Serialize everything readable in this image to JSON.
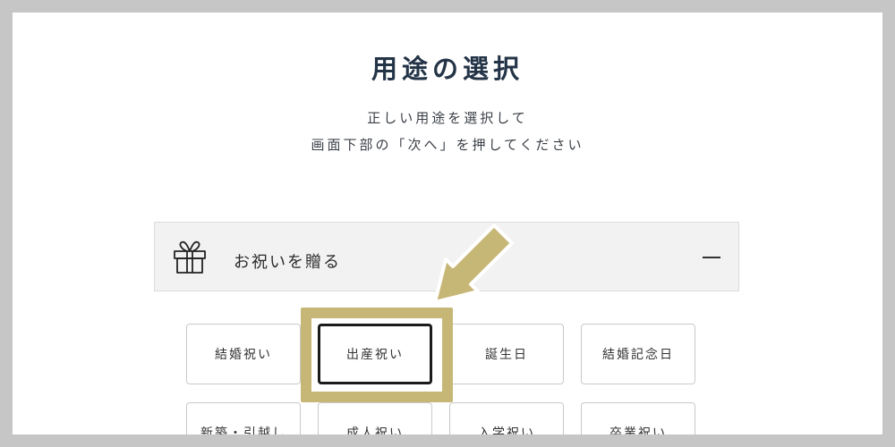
{
  "page": {
    "title": "用途の選択",
    "instruction_line1": "正しい用途を選択して",
    "instruction_line2": "画面下部の「次へ」を押してください"
  },
  "accordion": {
    "label": "お祝いを贈る",
    "icon": "gift-icon",
    "toggle_icon": "minus-icon",
    "expanded": true
  },
  "options": [
    {
      "label": "結婚祝い",
      "selected": false
    },
    {
      "label": "出産祝い",
      "selected": true
    },
    {
      "label": "誕生日",
      "selected": false
    },
    {
      "label": "結婚記念日",
      "selected": false
    },
    {
      "label": "新築・引越し",
      "selected": false
    },
    {
      "label": "成人祝い",
      "selected": false
    },
    {
      "label": "入学祝い",
      "selected": false
    },
    {
      "label": "卒業祝い",
      "selected": false
    }
  ],
  "annotation": {
    "highlight_color": "#c7b776",
    "arrow_color": "#c7b776"
  }
}
